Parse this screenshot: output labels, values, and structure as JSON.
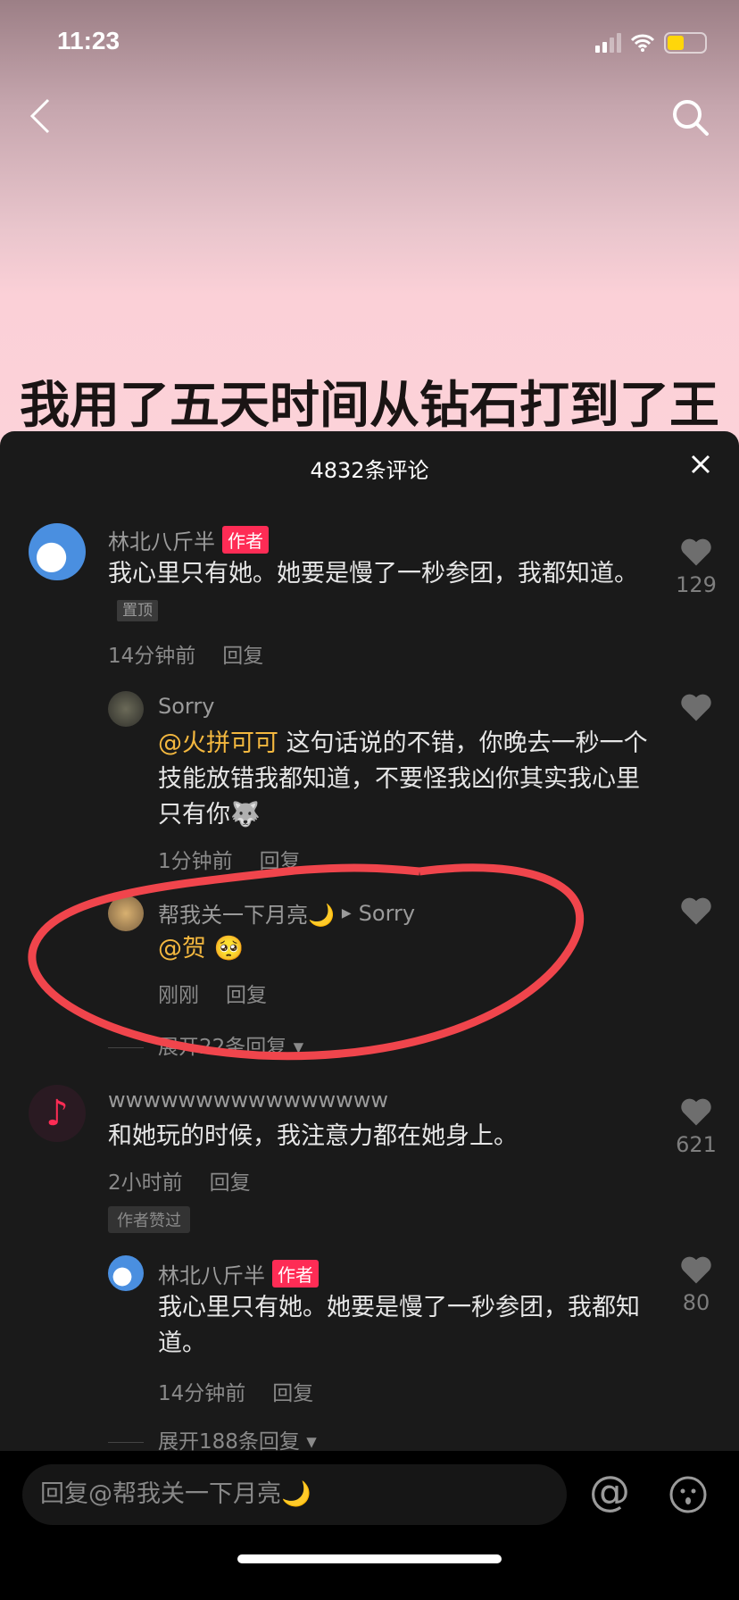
{
  "status_bar": {
    "time": "11:23"
  },
  "video": {
    "title": "我用了五天时间从钻石打到了王者"
  },
  "sheet": {
    "title": "4832条评论"
  },
  "comments": [
    {
      "user": "林北八斤半",
      "tag": "作者",
      "text": "我心里只有她。她要是慢了一秒参团，我都知道。",
      "pin": "置顶",
      "time": "14分钟前",
      "reply": "回复",
      "likes": "129",
      "replies": [
        {
          "user": "Sorry",
          "mention": "@火拼可可",
          "text": " 这句话说的不错，你晚去一秒一个技能放错我都知道，不要怪我凶你其实我心里只有你",
          "emoji": "🐺",
          "time": "1分钟前",
          "reply": "回复"
        },
        {
          "user": "帮我关一下月亮🌙",
          "reply_to": "Sorry",
          "mention": "@贺",
          "emoji": "🥺",
          "time": "刚刚",
          "reply": "回复"
        }
      ],
      "expand": "展开22条回复"
    },
    {
      "user": "wwwwwwwwwwwwwwww",
      "text": "和她玩的时候，我注意力都在她身上。",
      "time": "2小时前",
      "reply": "回复",
      "badge": "作者赞过",
      "likes": "621",
      "replies": [
        {
          "user": "林北八斤半",
          "tag": "作者",
          "text": "我心里只有她。她要是慢了一秒参团，我都知道。",
          "time": "14分钟前",
          "reply": "回复",
          "likes": "80"
        }
      ],
      "expand": "展开188条回复"
    }
  ],
  "input": {
    "placeholder": "回复@帮我关一下月亮🌙"
  },
  "colors": {
    "accent": "#fe2c55",
    "mention": "#f4b83f",
    "annotation": "#f0454c"
  }
}
